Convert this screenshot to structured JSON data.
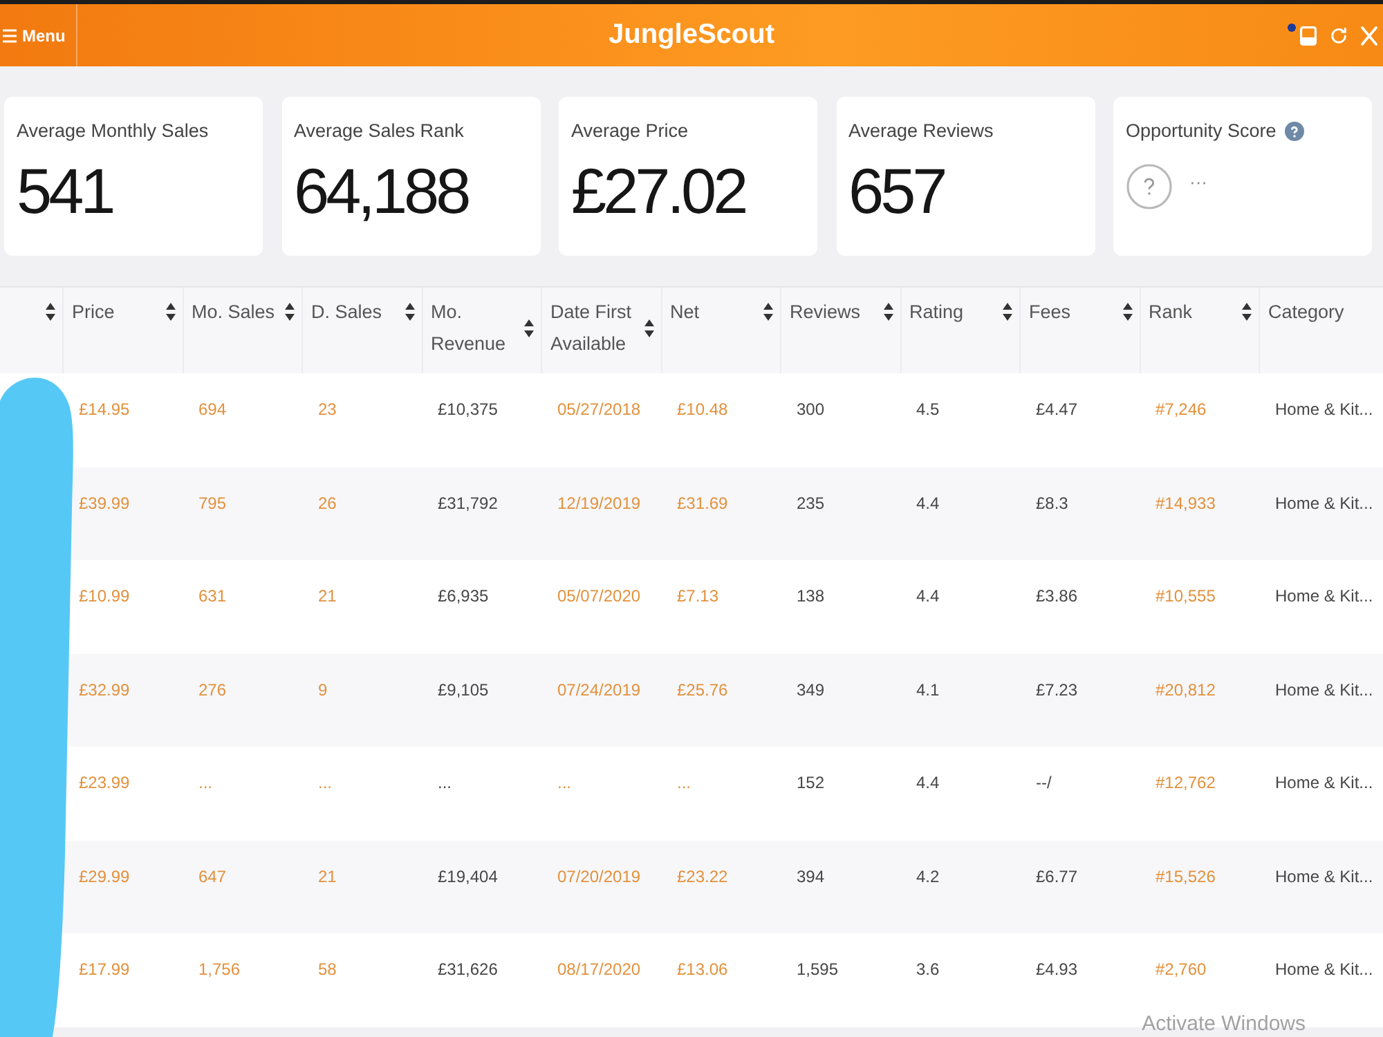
{
  "app_bar": {
    "menu_label": "Menu",
    "title": "JungleScout"
  },
  "stats": [
    {
      "label": "Average Monthly Sales",
      "value": "541",
      "kind": "number"
    },
    {
      "label": "Average Sales Rank",
      "value": "64,188",
      "kind": "number"
    },
    {
      "label": "Average Price",
      "value": "£27.02",
      "kind": "number"
    },
    {
      "label": "Average Reviews",
      "value": "657",
      "kind": "number"
    },
    {
      "label": "Opportunity Score",
      "value": "···",
      "kind": "score"
    }
  ],
  "table": {
    "columns": [
      {
        "label": "Price",
        "kind": "accent"
      },
      {
        "label": "Mo. Sales",
        "kind": "accent"
      },
      {
        "label": "D. Sales",
        "kind": "accent"
      },
      {
        "label": "Mo. Revenue",
        "kind": "plain"
      },
      {
        "label": "Date First Available",
        "kind": "accent"
      },
      {
        "label": "Net",
        "kind": "accent"
      },
      {
        "label": "Reviews",
        "kind": "plain"
      },
      {
        "label": "Rating",
        "kind": "plain"
      },
      {
        "label": "Fees",
        "kind": "plain"
      },
      {
        "label": "Rank",
        "kind": "accent"
      },
      {
        "label": "Category",
        "kind": "plain"
      }
    ],
    "rows": [
      {
        "cells": [
          "£14.95",
          "694",
          "23",
          "£10,375",
          "05/27/2018",
          "£10.48",
          "300",
          "4.5",
          "£4.47",
          "#7,246",
          "Home & Kit..."
        ]
      },
      {
        "cells": [
          "£39.99",
          "795",
          "26",
          "£31,792",
          "12/19/2019",
          "£31.69",
          "235",
          "4.4",
          "£8.3",
          "#14,933",
          "Home & Kit..."
        ]
      },
      {
        "cells": [
          "£10.99",
          "631",
          "21",
          "£6,935",
          "05/07/2020",
          "£7.13",
          "138",
          "4.4",
          "£3.86",
          "#10,555",
          "Home & Kit..."
        ]
      },
      {
        "cells": [
          "£32.99",
          "276",
          "9",
          "£9,105",
          "07/24/2019",
          "£25.76",
          "349",
          "4.1",
          "£7.23",
          "#20,812",
          "Home & Kit..."
        ]
      },
      {
        "cells": [
          "£23.99",
          "...",
          "...",
          "...",
          "...",
          "...",
          "152",
          "4.4",
          "--/",
          "#12,762",
          "Home & Kit..."
        ]
      },
      {
        "cells": [
          "£29.99",
          "647",
          "21",
          "£19,404",
          "07/20/2019",
          "£23.22",
          "394",
          "4.2",
          "£6.77",
          "#15,526",
          "Home & Kit..."
        ]
      },
      {
        "cells": [
          "£17.99",
          "1,756",
          "58",
          "£31,626",
          "08/17/2020",
          "£13.06",
          "1,595",
          "3.6",
          "£4.93",
          "#2,760",
          "Home & Kit..."
        ]
      }
    ]
  },
  "os_notice": "Activate Windows"
}
